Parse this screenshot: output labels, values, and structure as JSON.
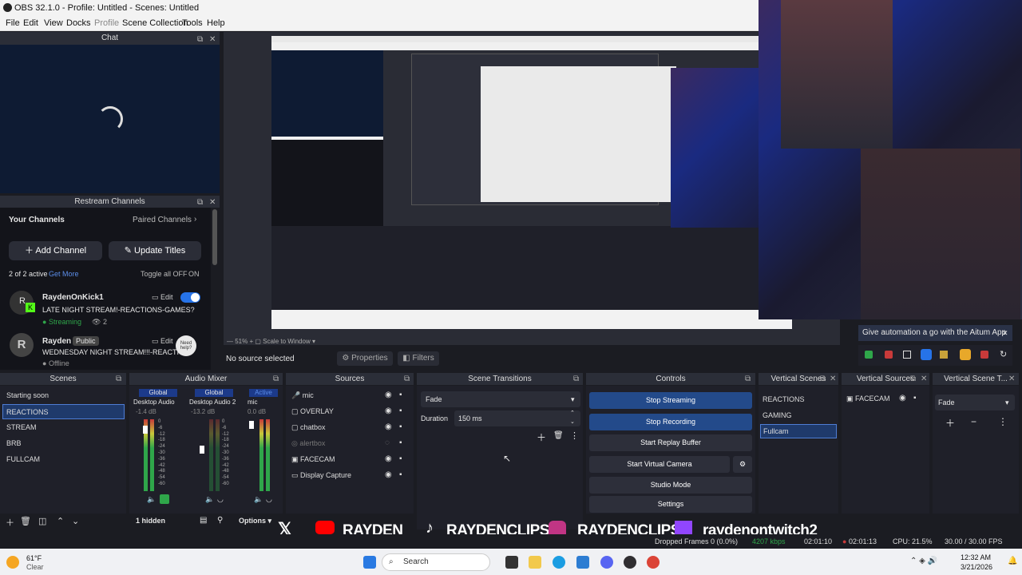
{
  "window": {
    "title": "OBS 32.1.0 - Profile: Untitled - Scenes: Untitled"
  },
  "menu": [
    "File",
    "Edit",
    "View",
    "Docks",
    "Profile",
    "Scene Collection",
    "Tools",
    "Help"
  ],
  "chat": {
    "title": "Chat"
  },
  "restream": {
    "title": "Restream Channels",
    "your_channels": "Your Channels",
    "paired_channels": "Paired Channels",
    "add_channel": "Add Channel",
    "update_titles": "Update Titles",
    "active_text": "2 of 2 active",
    "get_more": "Get More",
    "toggle_all": "Toggle all OFF",
    "on_label": "ON",
    "channels": [
      {
        "name": "RaydenOnKick1",
        "badge": "",
        "edit": "Edit",
        "title": "LATE NIGHT STREAM!-REACTIONS-GAMES?",
        "status": "Streaming",
        "viewers": "2"
      },
      {
        "name": "Rayden",
        "badge": "Public",
        "edit": "Edit",
        "title": "WEDNESDAY NIGHT STREAM!!!-REACTIO...",
        "status": "Offline",
        "viewers": ""
      }
    ],
    "need_help": "Need help?"
  },
  "preview": {
    "no_source": "No source selected",
    "properties": "Properties",
    "filters": "Filters"
  },
  "automation": {
    "text": "Give automation a go with the Aitum App"
  },
  "scenes": {
    "title": "Scenes",
    "items": [
      "Starting soon",
      "REACTIONS",
      "STREAM",
      "BRB",
      "FULLCAM"
    ],
    "selected": "REACTIONS"
  },
  "audio_mixer": {
    "title": "Audio Mixer",
    "channels": [
      {
        "tag": "Global",
        "name": "Desktop Audio",
        "db": "-1.4 dB"
      },
      {
        "tag": "Global",
        "name": "Desktop Audio 2",
        "db": "-13.2 dB"
      },
      {
        "tag": "Active",
        "name": "mic",
        "db": "0.0 dB"
      }
    ],
    "scale": [
      "0",
      "-6",
      "-12",
      "-18",
      "-24",
      "-30",
      "-36",
      "-42",
      "-48",
      "-54",
      "-60"
    ],
    "hidden": "1 hidden",
    "options": "Options"
  },
  "sources": {
    "title": "Sources",
    "items": [
      "mic",
      "OVERLAY",
      "chatbox",
      "alertbox",
      "FACECAM",
      "Display Capture"
    ]
  },
  "transitions": {
    "title": "Scene Transitions",
    "type": "Fade",
    "duration_label": "Duration",
    "duration": "150 ms"
  },
  "controls": {
    "title": "Controls",
    "buttons": [
      "Stop Streaming",
      "Stop Recording",
      "Start Replay Buffer",
      "Start Virtual Camera",
      "Studio Mode",
      "Settings"
    ]
  },
  "vertical_scenes": {
    "title": "Vertical Scenes",
    "items": [
      "REACTIONS",
      "GAMING",
      "Fullcam"
    ],
    "selected": "Fullcam"
  },
  "vertical_sources": {
    "title": "Vertical Sources",
    "items": [
      "FACECAM"
    ]
  },
  "vertical_transition": {
    "title": "Vertical Scene T...",
    "type": "Fade"
  },
  "banner": {
    "items": [
      "RAYDEN",
      "RAYDENCLIPS1",
      "RAYDENCLIPS",
      "raydenontwitch2"
    ]
  },
  "statusbar": {
    "dropped": "Dropped Frames 0 (0.0%)",
    "kbps": "4207 kbps",
    "stream_time": "02:01:10",
    "rec_time": "02:01:13",
    "cpu": "CPU: 21.5%",
    "fps": "30.00 / 30.00 FPS"
  },
  "taskbar": {
    "weather_temp": "61°F",
    "weather_desc": "Clear",
    "search": "Search",
    "time": "12:32 AM",
    "date": "3/21/2026"
  },
  "colors": {
    "accent": "#234a8a",
    "selection": "#1f3a6b",
    "streaming_green": "#2fa64a",
    "twitch": "#9146ff",
    "youtube": "#ff0000"
  }
}
